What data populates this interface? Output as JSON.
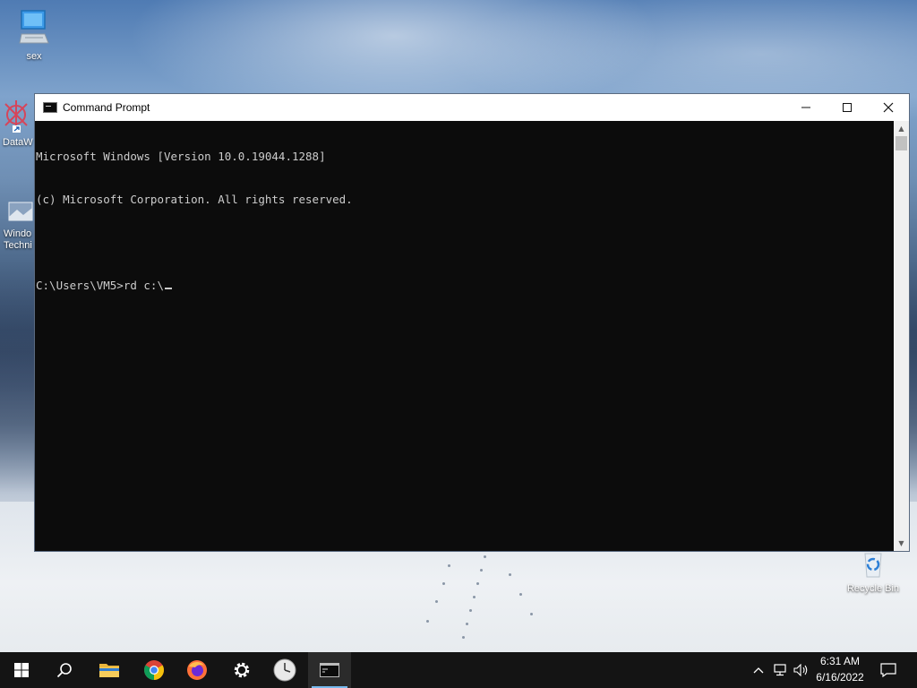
{
  "desktop": {
    "icons": [
      {
        "label": "sex",
        "icon": "computer-icon"
      },
      {
        "label": "DataW",
        "icon": "datawrapper-icon"
      },
      {
        "label": "Windo Techni",
        "icon": "wallpaper-shortcut-icon"
      },
      {
        "label": "Recycle Bin",
        "icon": "recycle-bin-icon"
      }
    ]
  },
  "window": {
    "title": "Command Prompt",
    "minimize_glyph": "—",
    "maximize_glyph": "☐",
    "close_glyph": "✕",
    "console_lines": [
      "Microsoft Windows [Version 10.0.19044.1288]",
      "(c) Microsoft Corporation. All rights reserved.",
      "",
      "C:\\Users\\VM5>rd c:\\"
    ],
    "background_color": "#0c0c0c",
    "text_color": "#cccccc"
  },
  "taskbar": {
    "items": [
      {
        "name": "start-button",
        "icon": "windows-logo-icon"
      },
      {
        "name": "search-button",
        "icon": "search-icon"
      },
      {
        "name": "file-explorer",
        "icon": "folder-icon"
      },
      {
        "name": "chrome",
        "icon": "chrome-icon"
      },
      {
        "name": "firefox",
        "icon": "firefox-icon"
      },
      {
        "name": "settings",
        "icon": "gear-icon"
      },
      {
        "name": "clock-app",
        "icon": "clock-icon"
      },
      {
        "name": "command-prompt",
        "icon": "terminal-icon",
        "active": true
      }
    ],
    "tray": {
      "chevron": "^",
      "time": "6:31 AM",
      "date": "6/16/2022"
    },
    "accent_color": "#76b9ed"
  }
}
